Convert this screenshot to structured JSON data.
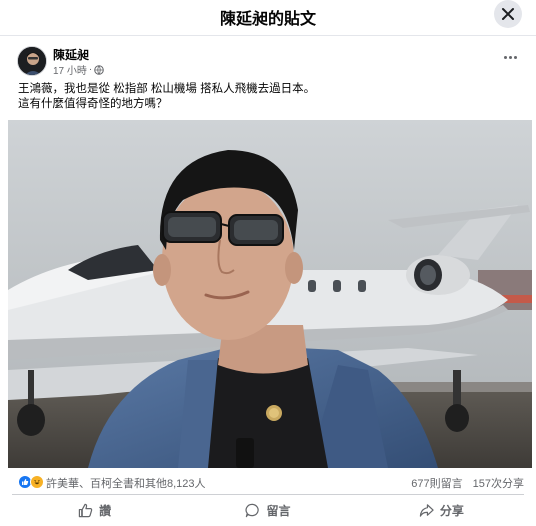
{
  "header": {
    "title": "陳延昶的貼文",
    "close_icon": "close-icon"
  },
  "post": {
    "author": "陳延昶",
    "time": "17 小時",
    "separator": "·",
    "privacy_icon": "globe-icon",
    "more_icon": "more-horizontal-icon",
    "text_line1": "王鴻薇，我也是從 松指部 松山機場 搭私人飛機去過日本。",
    "text_line2": "這有什麼值得奇怪的地方嗎？",
    "photo_icon": "selfie-photo"
  },
  "reactions": {
    "icons": [
      "like-icon",
      "haha-icon"
    ],
    "summary": "許美華、百柯全書和其他8,123人",
    "comments": "677則留言",
    "shares": "157次分享"
  },
  "actions": {
    "like": "讚",
    "comment": "留言",
    "share": "分享"
  },
  "colors": {
    "like_blue": "#1877f2",
    "haha_yellow": "#f7b125",
    "secondary_text": "#65676b"
  }
}
